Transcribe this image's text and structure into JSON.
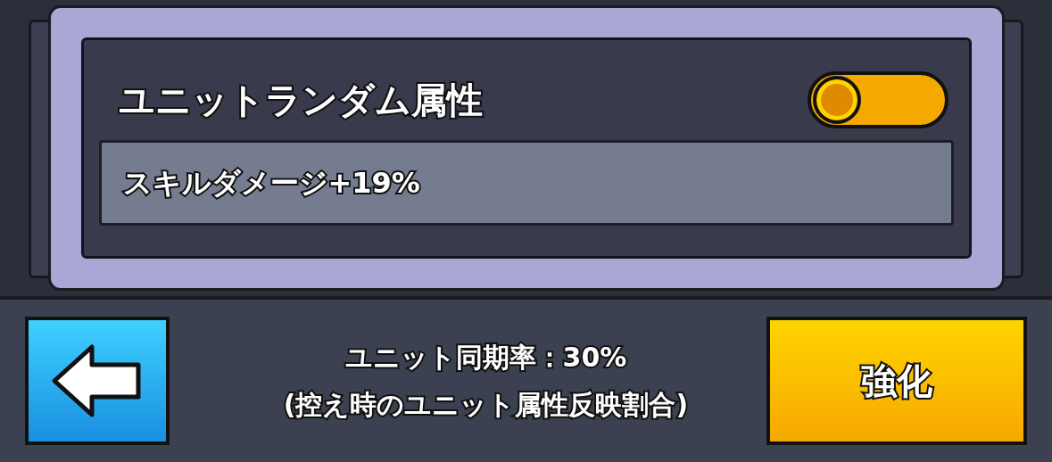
{
  "attribute_panel": {
    "title": "ユニットランダム属性",
    "toggle": {
      "on": true
    },
    "effect": "スキルダメージ+19%"
  },
  "footer": {
    "sync_rate": "ユニット同期率：30%",
    "sync_note": "(控え時のユニット属性反映割合)",
    "upgrade_button": "強化"
  }
}
